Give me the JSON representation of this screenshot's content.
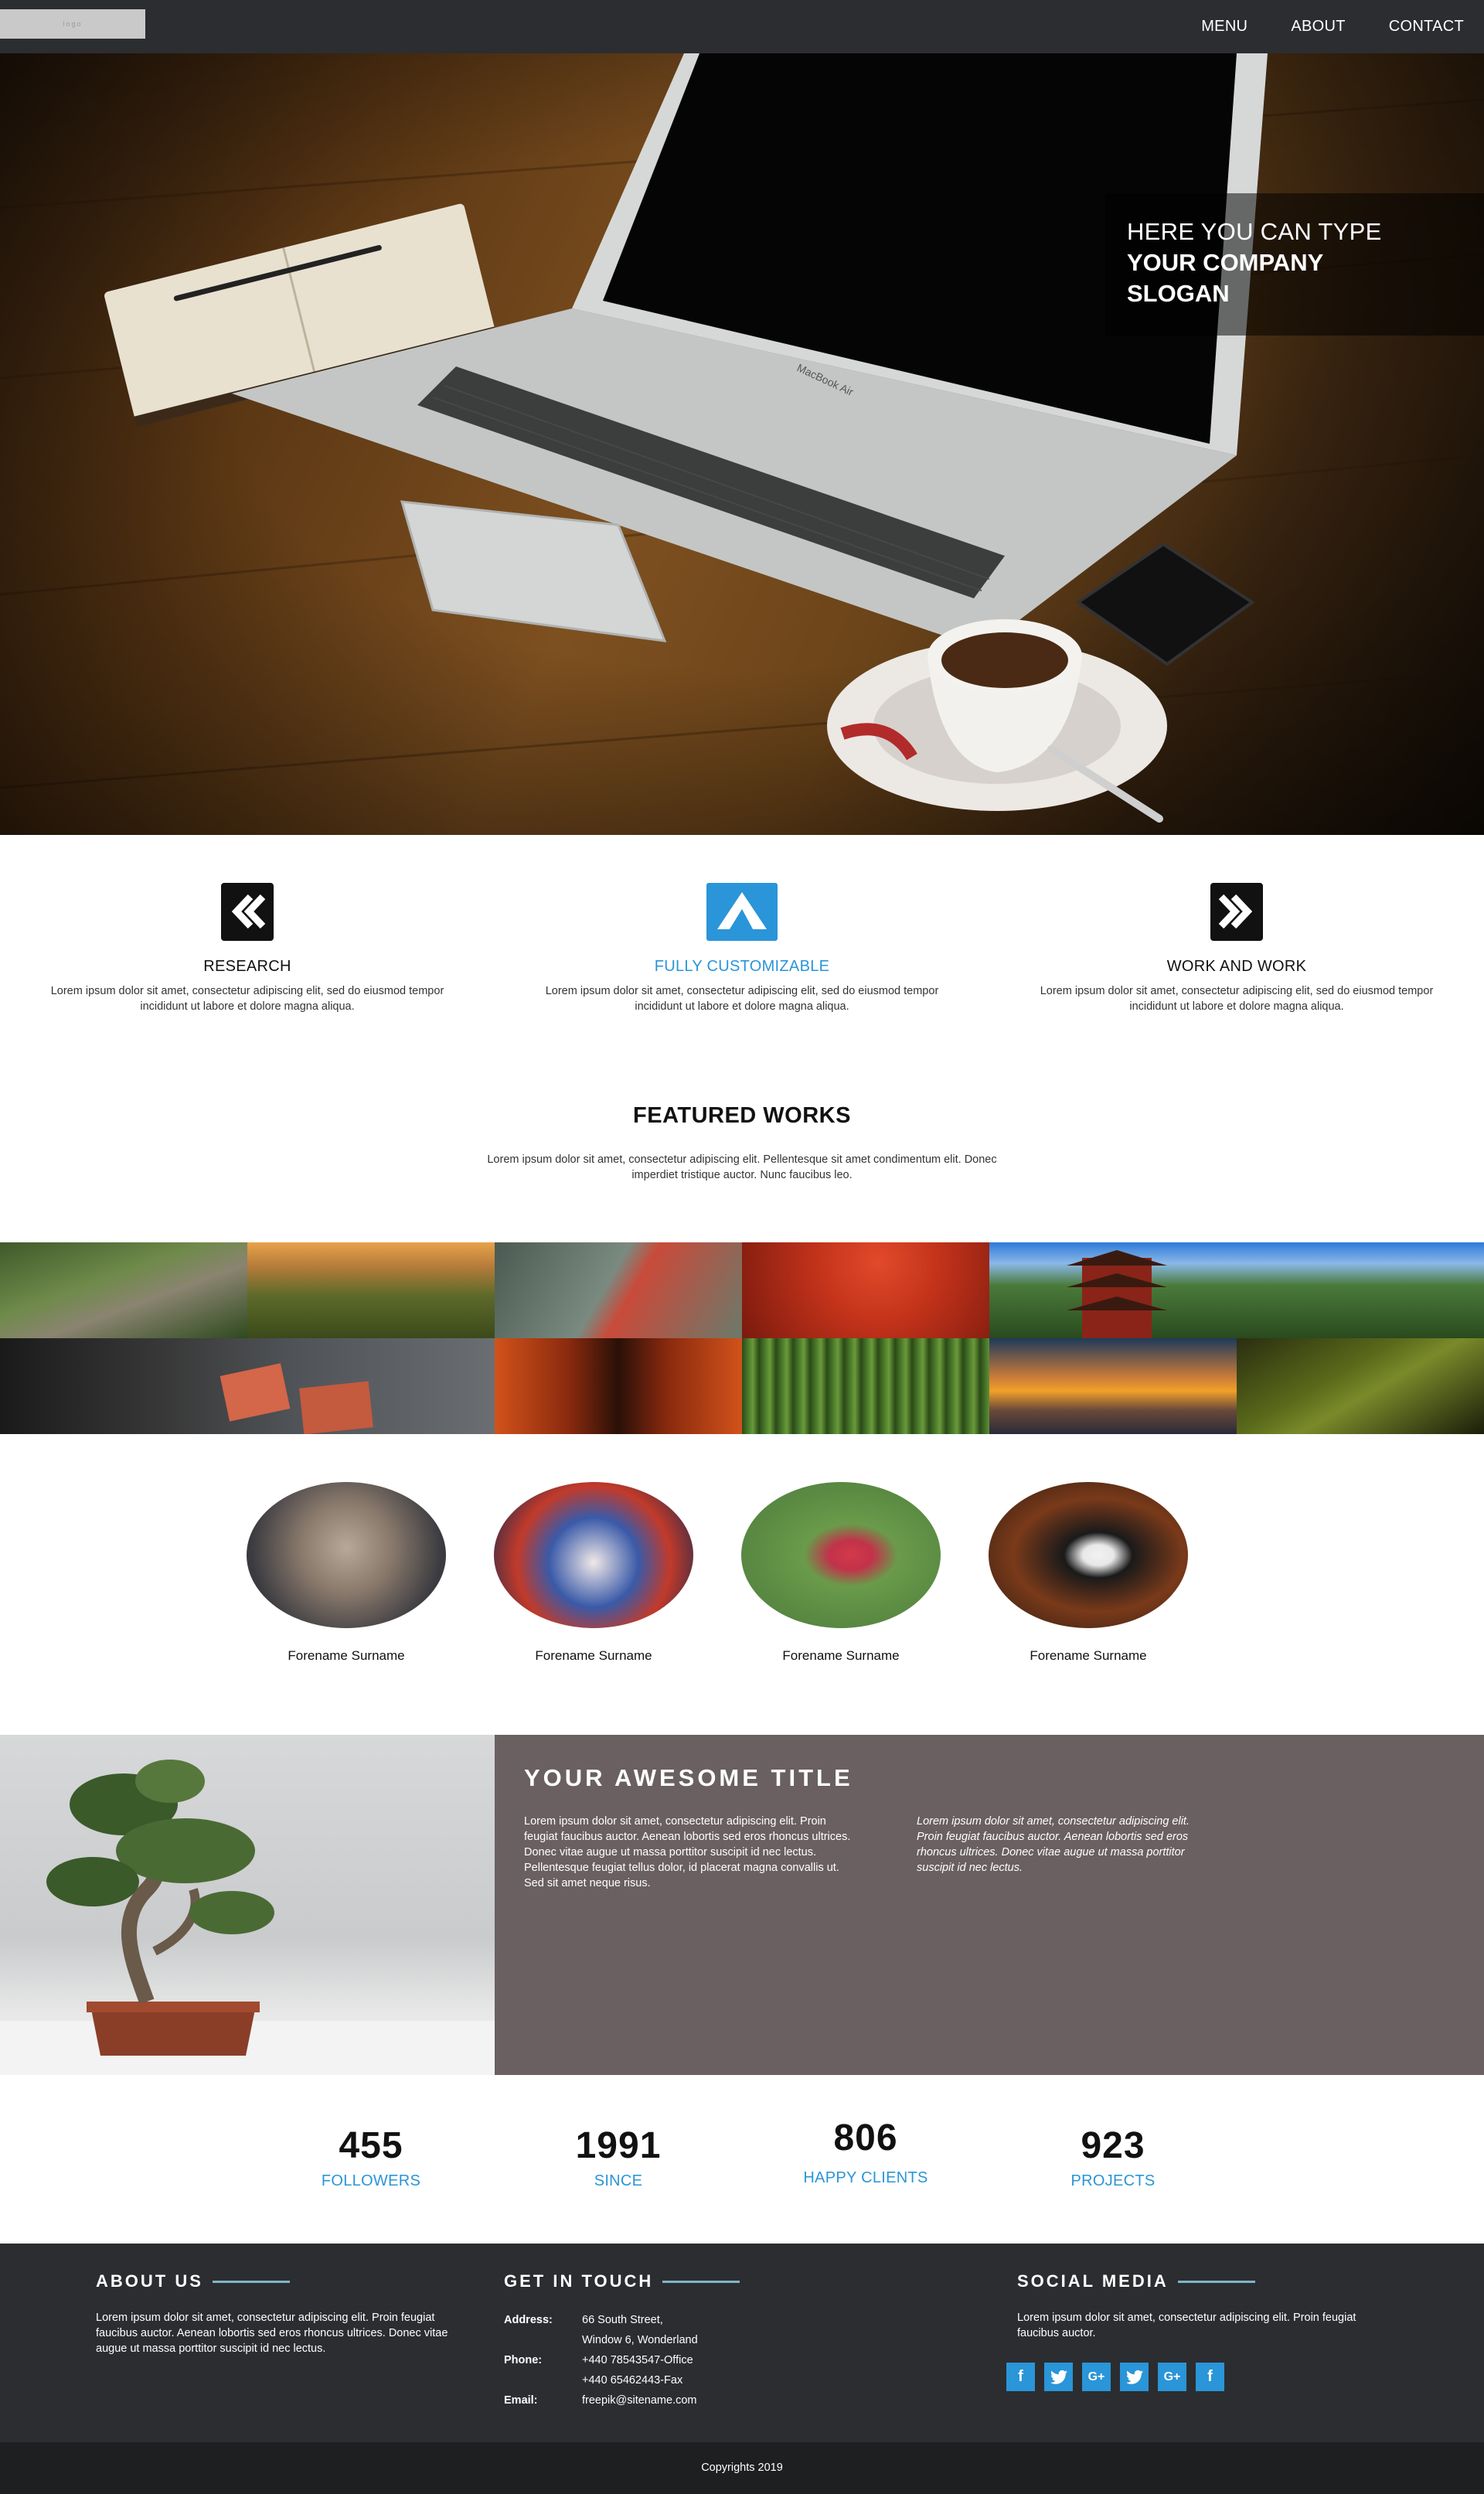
{
  "nav": {
    "logo_text": "logo",
    "items": [
      "MENU",
      "ABOUT",
      "CONTACT"
    ]
  },
  "hero": {
    "slogan_line1": "HERE YOU CAN TYPE",
    "slogan_line2": "YOUR COMPANY",
    "slogan_line3": "SLOGAN",
    "laptop_brand": "MacBook Air"
  },
  "features": [
    {
      "icon": "double-chevron-left-icon",
      "title": "RESEARCH",
      "text": "Lorem ipsum dolor sit amet, consectetur adipiscing elit, sed do eiusmod tempor incididunt ut labore et dolore magna aliqua."
    },
    {
      "icon": "paper-plane-icon",
      "title": "FULLY CUSTOMIZABLE",
      "text": "Lorem ipsum dolor sit amet, consectetur adipiscing elit, sed do eiusmod tempor incididunt ut labore et dolore magna aliqua."
    },
    {
      "icon": "double-chevron-right-icon",
      "title": "WORK AND WORK",
      "text": "Lorem ipsum dolor sit amet, consectetur adipiscing elit, sed do eiusmod tempor incididunt ut labore et dolore magna aliqua."
    }
  ],
  "featured": {
    "title": "FEATURED WORKS",
    "subtitle": "Lorem ipsum dolor sit amet, consectetur adipiscing elit. Pellentesque sit amet condimentum elit. Donec imperdiet tristique auctor. Nunc faucibus leo."
  },
  "people": [
    {
      "name": "Forename Surname"
    },
    {
      "name": "Forename Surname"
    },
    {
      "name": "Forename Surname"
    },
    {
      "name": "Forename Surname"
    }
  ],
  "about_block": {
    "title": "YOUR AWESOME TITLE",
    "col1": "Lorem ipsum dolor sit amet, consectetur adipiscing elit. Proin feugiat faucibus auctor. Aenean lobortis sed eros rhoncus ultrices. Donec vitae augue ut massa porttitor suscipit id nec lectus. Pellentesque feugiat tellus dolor, id placerat magna convallis ut. Sed sit amet neque risus.",
    "col2": "Lorem ipsum dolor sit amet, consectetur adipiscing elit. Proin feugiat faucibus auctor. Aenean lobortis sed eros rhoncus ultrices. Donec vitae augue ut massa porttitor suscipit id nec lectus."
  },
  "stats": [
    {
      "value": "455",
      "label": "FOLLOWERS"
    },
    {
      "value": "1991",
      "label": "SINCE"
    },
    {
      "value": "806",
      "label": "HAPPY CLIENTS"
    },
    {
      "value": "923",
      "label": "PROJECTS"
    }
  ],
  "footer": {
    "about_title": "ABOUT US",
    "about_text": "Lorem ipsum dolor sit amet, consectetur adipiscing elit. Proin feugiat faucibus auctor. Aenean lobortis sed eros rhoncus ultrices. Donec vitae augue ut massa porttitor suscipit id nec lectus.",
    "touch_title": "GET IN TOUCH",
    "address_label": "Address:",
    "address_line1": "66 South Street,",
    "address_line2": "Window 6, Wonderland",
    "phone_label": "Phone:",
    "phone_line1": "+440 78543547-Office",
    "phone_line2": "+440 65462443-Fax",
    "email_label": "Email:",
    "email": "freepik@sitename.com",
    "social_title": "SOCIAL MEDIA",
    "social_text": "Lorem ipsum dolor sit amet, consectetur adipiscing elit. Proin feugiat faucibus auctor.",
    "social_icons": [
      "facebook-icon",
      "twitter-icon",
      "google-plus-icon",
      "twitter-icon",
      "google-plus-icon",
      "facebook-icon"
    ],
    "social_glyph_f": "f",
    "social_glyph_g": "G+",
    "copyright": "Copyrights 2019"
  },
  "colors": {
    "nav_bg": "#2c2d30",
    "accent": "#2a95d8",
    "about_panel": "#6a6061",
    "footer_bg": "#2c2d30",
    "copyright_bg": "#1e1f21"
  }
}
